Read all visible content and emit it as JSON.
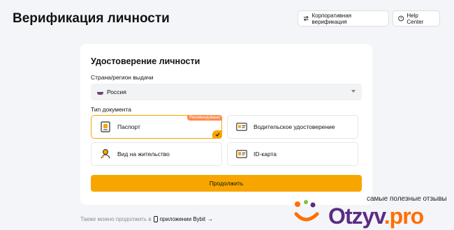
{
  "header": {
    "title": "Верификация личности",
    "corporate_label": "Корпоративная верификация",
    "help_label": "Help Center"
  },
  "card": {
    "title": "Удостоверение личности",
    "country_label": "Страна/регион выдачи",
    "country_value": "Россия",
    "doc_type_label": "Тип документа",
    "options": [
      {
        "label": "Паспорт",
        "badge": "Рекомендовано",
        "selected": true,
        "icon": "passport-icon"
      },
      {
        "label": "Водительское удостоверение",
        "icon": "drivers-license-icon"
      },
      {
        "label": "Вид на жительство",
        "icon": "residence-permit-icon"
      },
      {
        "label": "ID-карта",
        "icon": "id-card-icon"
      }
    ],
    "continue_label": "Продолжить"
  },
  "footer": {
    "prefix": "Также можно продолжить в",
    "link": "приложении Bybit",
    "arrow": "→"
  },
  "watermark": {
    "tagline": "самые полезные отзывы",
    "logo_part1": "Otzyv",
    "logo_part2": ".pro"
  },
  "colors": {
    "accent": "#f7a600",
    "badge": "#ff8a4c",
    "background": "#f4f5f8"
  }
}
